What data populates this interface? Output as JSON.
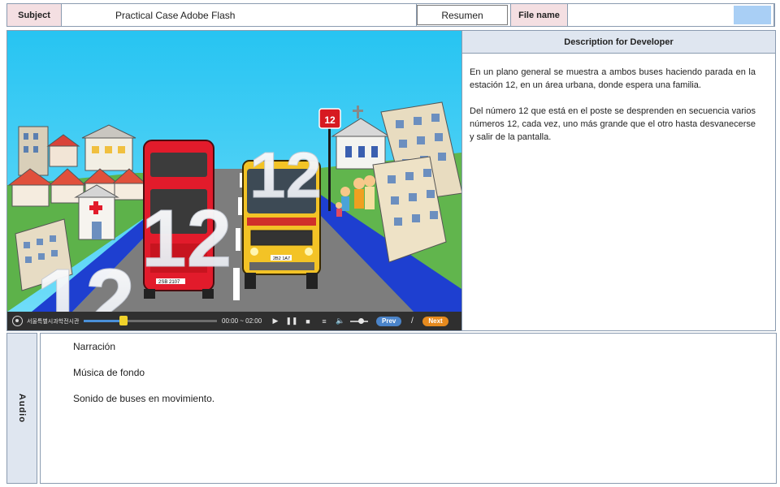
{
  "header": {
    "subject_label": "Subject",
    "subject_value": "Practical Case Adobe Flash",
    "resumen_button": "Resumen",
    "file_label": "File name",
    "file_value": ""
  },
  "scene": {
    "big_number": "12",
    "sign_number": "12",
    "left_bus_plate": "2SB 2107",
    "right_bus_plate": "2B2 1A7"
  },
  "player": {
    "org_name": "서울특별시과학전시관",
    "time": "00:00 ~ 02:00",
    "progress": 0.3,
    "volume": 0.6,
    "prev_label": "Prev",
    "separator": "/",
    "next_label": "Next",
    "play_icon": "▶",
    "pause_icon": "❚❚",
    "stop_icon": "■",
    "menu_icon": "≡",
    "volume_icon": "🔈"
  },
  "description": {
    "title": "Description for Developer",
    "paragraphs": [
      "En un plano general se muestra a ambos buses haciendo parada en la estación 12, en un área urbana, donde espera una familia.",
      "Del número 12 que está en el poste se desprenden en secuencia varios números 12, cada vez, uno más grande que el otro hasta desvanecerse y salir de la pantalla."
    ]
  },
  "audio": {
    "label": "Audio",
    "items": [
      "Narración",
      "Música de fondo",
      "Sonido de buses en movimiento."
    ]
  },
  "colors": {
    "label_pink": "#f4dfe2",
    "label_blue": "#dfe6f0",
    "border": "#8a9bb0",
    "sky": "#2ec8f4",
    "red_bus": "#e21b2b",
    "yellow_bus": "#f3c326",
    "road": "#7d7d7d",
    "curb_blue": "#1e3fd0",
    "grass": "#5db24a"
  }
}
